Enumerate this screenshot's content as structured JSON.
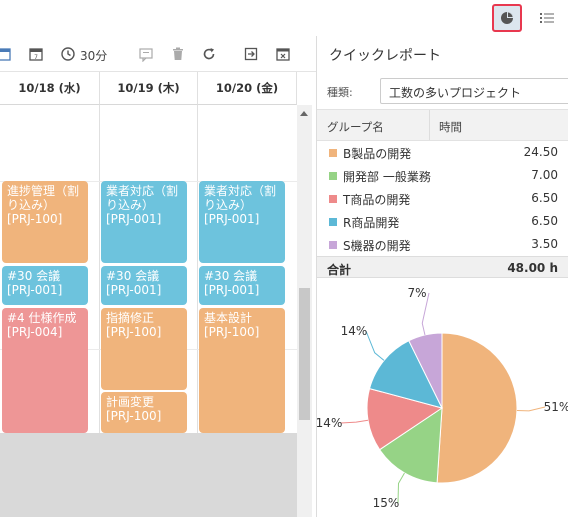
{
  "topbar": {
    "pie_icon": "pie-chart-icon",
    "list_icon": "list-icon"
  },
  "toolbar": {
    "interval": "30分",
    "icons": [
      "calendar-week-icon",
      "calendar-day-icon",
      "clock-icon",
      "comment-icon",
      "trash-icon",
      "refresh-icon",
      "export-icon",
      "calendar-close-icon"
    ]
  },
  "calendar": {
    "columns": [
      "10/18 (水)",
      "10/19 (木)",
      "10/20 (金)"
    ],
    "events": [
      {
        "col": 0,
        "color": "orange",
        "lines": [
          "進捗管理（割",
          "り込み）",
          "[PRJ-100]"
        ]
      },
      {
        "col": 0,
        "color": "blue",
        "lines": [
          "#30 会議",
          "[PRJ-001]"
        ]
      },
      {
        "col": 0,
        "color": "red",
        "lines": [
          "#4 仕様作成",
          "[PRJ-004]"
        ]
      },
      {
        "col": 1,
        "color": "blue",
        "lines": [
          "業者対応（割",
          "り込み）",
          "[PRJ-001]"
        ]
      },
      {
        "col": 1,
        "color": "blue",
        "lines": [
          "#30 会議",
          "[PRJ-001]"
        ]
      },
      {
        "col": 1,
        "color": "orange",
        "lines": [
          "指摘修正",
          "[PRJ-100]"
        ]
      },
      {
        "col": 1,
        "color": "orange",
        "lines": [
          "計画変更",
          "[PRJ-100]"
        ]
      },
      {
        "col": 2,
        "color": "blue",
        "lines": [
          "業者対応（割",
          "り込み）",
          "[PRJ-001]"
        ]
      },
      {
        "col": 2,
        "color": "blue",
        "lines": [
          "#30 会議",
          "[PRJ-001]"
        ]
      },
      {
        "col": 2,
        "color": "orange",
        "lines": [
          "基本設計",
          "[PRJ-100]"
        ]
      }
    ]
  },
  "report": {
    "title": "クイックレポート",
    "kind_label": "種類:",
    "kind_value": "工数の多いプロジェクト",
    "col_group": "グループ名",
    "col_time": "時間",
    "rows": [
      {
        "name": "B製品の開発",
        "value": "24.50",
        "color": "#f0b47c"
      },
      {
        "name": "開発部 一般業務",
        "value": "7.00",
        "color": "#96d386"
      },
      {
        "name": "T商品の開発",
        "value": "6.50",
        "color": "#ee8a8a"
      },
      {
        "name": "R商品開発",
        "value": "6.50",
        "color": "#5cb8d6"
      },
      {
        "name": "S機器の開発",
        "value": "3.50",
        "color": "#c7a6d8"
      }
    ],
    "total_label": "合計",
    "total_value": "48.00 h"
  },
  "chart_data": {
    "type": "pie",
    "categories": [
      "B製品の開発",
      "開発部 一般業務",
      "T商品の開発",
      "R商品開発",
      "S機器の開発"
    ],
    "values": [
      24.5,
      7.0,
      6.5,
      6.5,
      3.5
    ],
    "labels": [
      "51%",
      "15%",
      "14%",
      "14%",
      "7%"
    ],
    "colors": [
      "#f0b47c",
      "#96d386",
      "#ee8a8a",
      "#5cb8d6",
      "#c7a6d8"
    ]
  }
}
